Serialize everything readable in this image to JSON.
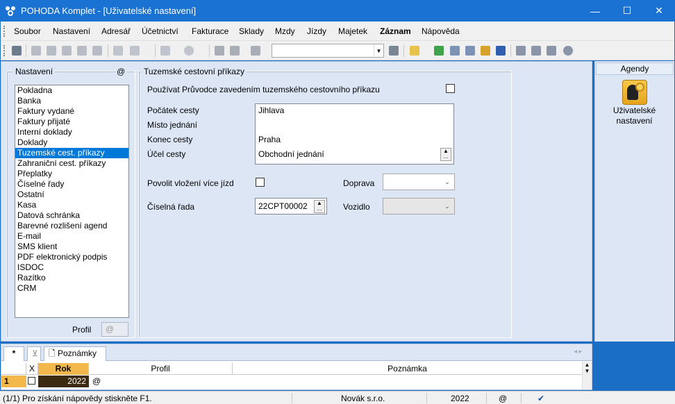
{
  "window": {
    "title": "POHODA Komplet - [Uživatelské nastavení]",
    "minimize": "—",
    "maximize": "☐",
    "close": "✕",
    "app_icon": "pohoda-logo-icon"
  },
  "menu": [
    {
      "label": "Soubor",
      "bold": false
    },
    {
      "label": "Nastavení",
      "bold": false
    },
    {
      "label": "Adresář",
      "bold": false
    },
    {
      "label": "Účetnictví",
      "bold": false
    },
    {
      "label": "Fakturace",
      "bold": false
    },
    {
      "label": "Sklady",
      "bold": false
    },
    {
      "label": "Mzdy",
      "bold": false
    },
    {
      "label": "Jízdy",
      "bold": false
    },
    {
      "label": "Majetek",
      "bold": false
    },
    {
      "label": "Záznam",
      "bold": true
    },
    {
      "label": "Nápověda",
      "bold": false
    }
  ],
  "toolbar": {
    "combo_value": "",
    "combo_arrow": "▼",
    "icons": [
      "new-record-icon",
      "copy-icon",
      "paste-icon",
      "print-icon",
      "export-icon",
      "delete-icon",
      "edit-icon",
      "check-icon",
      "back-icon",
      "settings-icon",
      "save-icon",
      "save-all-icon",
      "duplicate-icon",
      "filter-icon",
      "folder-icon",
      "money-icon",
      "calculator-icon",
      "calendar-icon",
      "coins-icon",
      "iban-icon",
      "list-icon",
      "form-icon",
      "report-icon",
      "help-icon"
    ]
  },
  "left": {
    "legend": "Nastavení",
    "at_label": "@",
    "items": [
      "Pokladna",
      "Banka",
      "Faktury vydané",
      "Faktury přijaté",
      "Interní doklady",
      "Doklady",
      "Tuzemské cest. příkazy",
      "Zahraniční cest. příkazy",
      "Přeplatky",
      "Číselné řady",
      "Ostatní",
      "Kasa",
      "Datová schránka",
      "Barevné rozlišení agend",
      "E-mail",
      "SMS klient",
      "PDF elektronický podpis",
      "ISDOC",
      "Razítko",
      "CRM"
    ],
    "selected_index": 6,
    "profil_label": "Profil",
    "profil_value": "@"
  },
  "right_panel": {
    "legend": "Tuzemské cestovní příkazy",
    "wizard_label": "Používat Průvodce zavedením tuzemského cestovního příkazu",
    "wizard_checked": false,
    "pocatek_label": "Počátek cesty",
    "pocatek_value": "Jihlava",
    "misto_label": "Místo jednání",
    "misto_value": "",
    "konec_label": "Konec cesty",
    "konec_value": "Praha",
    "ucel_label": "Účel cesty",
    "ucel_value": "Obchodní jednání",
    "multi_label": "Povolit vložení více jízd",
    "multi_checked": false,
    "doprava_label": "Doprava",
    "doprava_value": "",
    "rada_label": "Číselná řada",
    "rada_value": "22CPT00002",
    "vozidlo_label": "Vozidlo",
    "vozidlo_value": "",
    "dots": "▲\n…",
    "dropdown_arrow": "⌄"
  },
  "agendy": {
    "header": "Agendy",
    "item_label_1": "Uživatelské",
    "item_label_2": "nastavení",
    "icon": "user-settings-icon"
  },
  "bottom": {
    "tab_star": "*",
    "tab_notes": "Poznámky",
    "nav": "◂ ▸",
    "columns": {
      "x": "X",
      "rok": "Rok",
      "profil": "Profil",
      "poznamka": "Poznámka"
    },
    "row": {
      "num": "1",
      "rok": "2022",
      "profil": "@",
      "poznamka": ""
    }
  },
  "status": {
    "help": "(1/1) Pro získání nápovědy stiskněte F1.",
    "company": "Novák s.r.o.",
    "year": "2022",
    "at": "@",
    "check": "✔"
  }
}
